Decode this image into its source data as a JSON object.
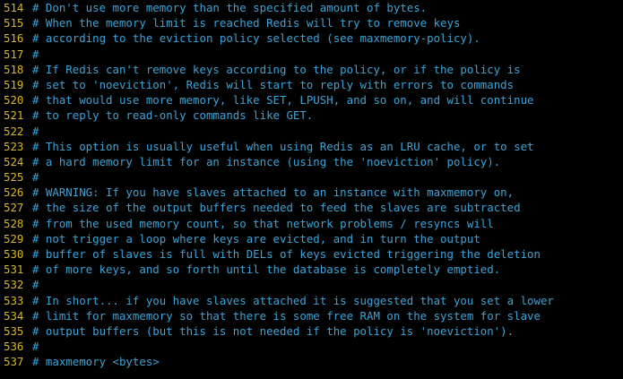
{
  "editor": {
    "lines": [
      {
        "num": "514",
        "text": "# Don't use more memory than the specified amount of bytes."
      },
      {
        "num": "515",
        "text": "# When the memory limit is reached Redis will try to remove keys"
      },
      {
        "num": "516",
        "text": "# according to the eviction policy selected (see maxmemory-policy)."
      },
      {
        "num": "517",
        "text": "#"
      },
      {
        "num": "518",
        "text": "# If Redis can't remove keys according to the policy, or if the policy is"
      },
      {
        "num": "519",
        "text": "# set to 'noeviction', Redis will start to reply with errors to commands"
      },
      {
        "num": "520",
        "text": "# that would use more memory, like SET, LPUSH, and so on, and will continue"
      },
      {
        "num": "521",
        "text": "# to reply to read-only commands like GET."
      },
      {
        "num": "522",
        "text": "#"
      },
      {
        "num": "523",
        "text": "# This option is usually useful when using Redis as an LRU cache, or to set"
      },
      {
        "num": "524",
        "text": "# a hard memory limit for an instance (using the 'noeviction' policy)."
      },
      {
        "num": "525",
        "text": "#"
      },
      {
        "num": "526",
        "text": "# WARNING: If you have slaves attached to an instance with maxmemory on,"
      },
      {
        "num": "527",
        "text": "# the size of the output buffers needed to feed the slaves are subtracted"
      },
      {
        "num": "528",
        "text": "# from the used memory count, so that network problems / resyncs will"
      },
      {
        "num": "529",
        "text": "# not trigger a loop where keys are evicted, and in turn the output"
      },
      {
        "num": "530",
        "text": "# buffer of slaves is full with DELs of keys evicted triggering the deletion"
      },
      {
        "num": "531",
        "text": "# of more keys, and so forth until the database is completely emptied."
      },
      {
        "num": "532",
        "text": "#"
      },
      {
        "num": "533",
        "text": "# In short... if you have slaves attached it is suggested that you set a lower"
      },
      {
        "num": "534",
        "text": "# limit for maxmemory so that there is some free RAM on the system for slave"
      },
      {
        "num": "535",
        "text": "# output buffers (but this is not needed if the policy is 'noeviction')."
      },
      {
        "num": "536",
        "text": "#"
      },
      {
        "num": "537",
        "text": "# maxmemory <bytes>"
      }
    ]
  },
  "colors": {
    "background": "#000000",
    "line_number": "#d7b52a",
    "comment": "#3ea3d6"
  }
}
